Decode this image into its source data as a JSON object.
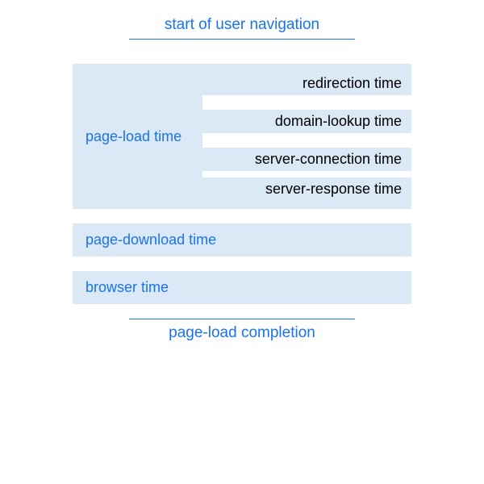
{
  "header": "start of user navigation",
  "footer": "page-load completion",
  "page_load": {
    "label": "page-load time",
    "sub": [
      "redirection time",
      "domain-lookup time",
      "server-connection time",
      "server-response time"
    ]
  },
  "bars": [
    "page-download time",
    "browser time"
  ]
}
